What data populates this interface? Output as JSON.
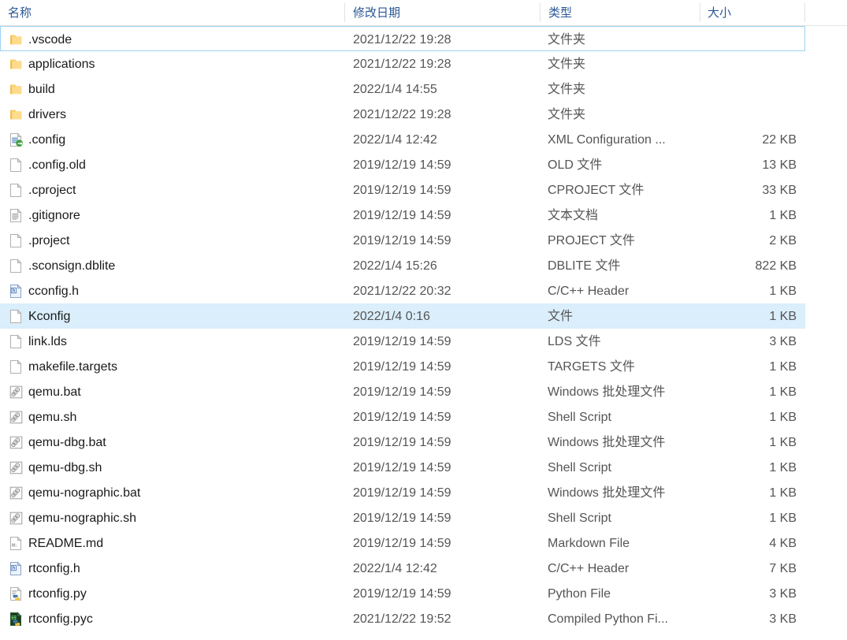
{
  "window": {
    "app": "file-explorer",
    "view_mode": "details"
  },
  "accent": {
    "header_text": "#2b5796",
    "row_hover_bg": "#daeefc",
    "focus_border": "#9fd2f2",
    "folder_icon": "#ffd475",
    "separator": "#e2e2e2"
  },
  "columns": [
    {
      "key": "name",
      "label": "名称"
    },
    {
      "key": "date",
      "label": "修改日期"
    },
    {
      "key": "type",
      "label": "类型"
    },
    {
      "key": "size",
      "label": "大小"
    }
  ],
  "files": [
    {
      "name": ".vscode",
      "date": "2021/12/22 19:28",
      "type": "文件夹",
      "size": "",
      "icon": "folder-icon",
      "state": "focus"
    },
    {
      "name": "applications",
      "date": "2021/12/22 19:28",
      "type": "文件夹",
      "size": "",
      "icon": "folder-icon",
      "state": ""
    },
    {
      "name": "build",
      "date": "2022/1/4 14:55",
      "type": "文件夹",
      "size": "",
      "icon": "folder-icon",
      "state": ""
    },
    {
      "name": "drivers",
      "date": "2021/12/22 19:28",
      "type": "文件夹",
      "size": "",
      "icon": "folder-icon",
      "state": ""
    },
    {
      "name": ".config",
      "date": "2022/1/4 12:42",
      "type": "XML Configuration ...",
      "size": "22 KB",
      "icon": "xml-config-file-icon",
      "state": ""
    },
    {
      "name": ".config.old",
      "date": "2019/12/19 14:59",
      "type": "OLD 文件",
      "size": "13 KB",
      "icon": "blank-file-icon",
      "state": ""
    },
    {
      "name": ".cproject",
      "date": "2019/12/19 14:59",
      "type": "CPROJECT 文件",
      "size": "33 KB",
      "icon": "blank-file-icon",
      "state": ""
    },
    {
      "name": ".gitignore",
      "date": "2019/12/19 14:59",
      "type": "文本文档",
      "size": "1 KB",
      "icon": "text-file-icon",
      "state": ""
    },
    {
      "name": ".project",
      "date": "2019/12/19 14:59",
      "type": "PROJECT 文件",
      "size": "2 KB",
      "icon": "blank-file-icon",
      "state": ""
    },
    {
      "name": ".sconsign.dblite",
      "date": "2022/1/4 15:26",
      "type": "DBLITE 文件",
      "size": "822 KB",
      "icon": "blank-file-icon",
      "state": ""
    },
    {
      "name": "cconfig.h",
      "date": "2021/12/22 20:32",
      "type": "C/C++ Header",
      "size": "1 KB",
      "icon": "header-file-icon",
      "state": ""
    },
    {
      "name": "Kconfig",
      "date": "2022/1/4 0:16",
      "type": "文件",
      "size": "1 KB",
      "icon": "blank-file-icon",
      "state": "hover"
    },
    {
      "name": "link.lds",
      "date": "2019/12/19 14:59",
      "type": "LDS 文件",
      "size": "3 KB",
      "icon": "blank-file-icon",
      "state": ""
    },
    {
      "name": "makefile.targets",
      "date": "2019/12/19 14:59",
      "type": "TARGETS 文件",
      "size": "1 KB",
      "icon": "blank-file-icon",
      "state": ""
    },
    {
      "name": "qemu.bat",
      "date": "2019/12/19 14:59",
      "type": "Windows 批处理文件",
      "size": "1 KB",
      "icon": "script-file-icon",
      "state": ""
    },
    {
      "name": "qemu.sh",
      "date": "2019/12/19 14:59",
      "type": "Shell Script",
      "size": "1 KB",
      "icon": "script-file-icon",
      "state": ""
    },
    {
      "name": "qemu-dbg.bat",
      "date": "2019/12/19 14:59",
      "type": "Windows 批处理文件",
      "size": "1 KB",
      "icon": "script-file-icon",
      "state": ""
    },
    {
      "name": "qemu-dbg.sh",
      "date": "2019/12/19 14:59",
      "type": "Shell Script",
      "size": "1 KB",
      "icon": "script-file-icon",
      "state": ""
    },
    {
      "name": "qemu-nographic.bat",
      "date": "2019/12/19 14:59",
      "type": "Windows 批处理文件",
      "size": "1 KB",
      "icon": "script-file-icon",
      "state": ""
    },
    {
      "name": "qemu-nographic.sh",
      "date": "2019/12/19 14:59",
      "type": "Shell Script",
      "size": "1 KB",
      "icon": "script-file-icon",
      "state": ""
    },
    {
      "name": "README.md",
      "date": "2019/12/19 14:59",
      "type": "Markdown File",
      "size": "4 KB",
      "icon": "markdown-file-icon",
      "state": ""
    },
    {
      "name": "rtconfig.h",
      "date": "2022/1/4 12:42",
      "type": "C/C++ Header",
      "size": "7 KB",
      "icon": "header-file-icon",
      "state": ""
    },
    {
      "name": "rtconfig.py",
      "date": "2019/12/19 14:59",
      "type": "Python File",
      "size": "3 KB",
      "icon": "python-file-icon",
      "state": ""
    },
    {
      "name": "rtconfig.pyc",
      "date": "2021/12/22 19:52",
      "type": "Compiled Python Fi...",
      "size": "3 KB",
      "icon": "python-compiled-file-icon",
      "state": ""
    }
  ]
}
